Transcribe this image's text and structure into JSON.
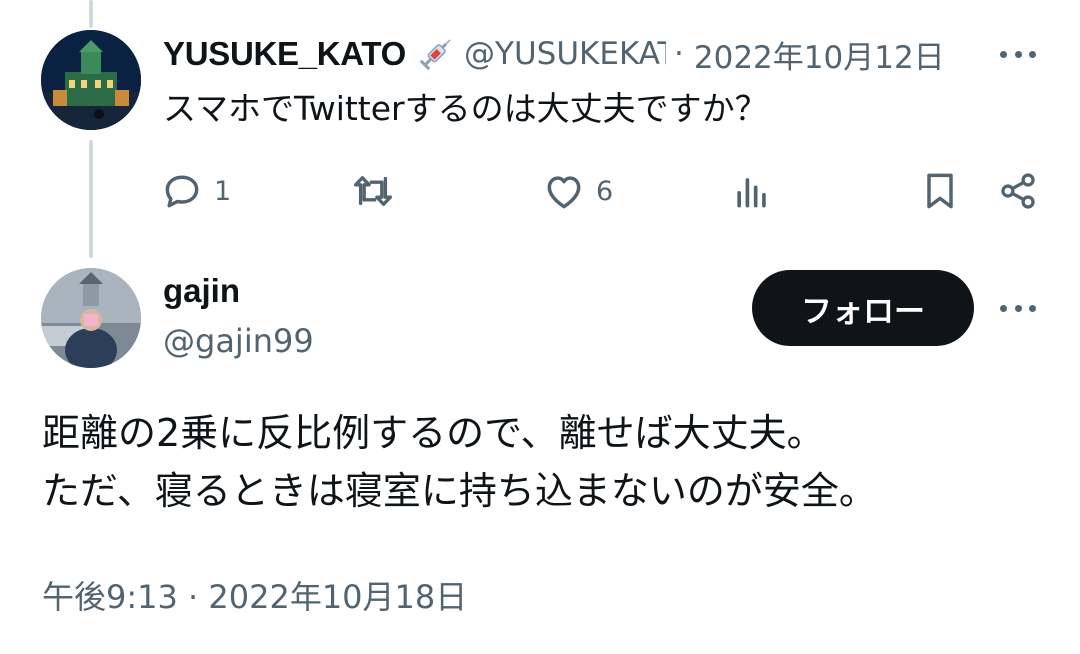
{
  "parent_tweet": {
    "display_name": "YUSUKE_KATO",
    "badge_icon": "syringe-emoji",
    "handle": "@YUSUKEKATO",
    "separator": "·",
    "date": "2022年10月12日",
    "text": "スマホでTwitterするのは大丈夫ですか？",
    "actions": {
      "reply_count": "1",
      "retweet_count": "",
      "like_count": "6"
    }
  },
  "reply_tweet": {
    "display_name": "gajin",
    "handle": "@gajin99",
    "follow_label": "フォロー",
    "body_lines": [
      "距離の2乗に反比例するので、離せば大丈夫。",
      "ただ、寝るときは寝室に持ち込まないのが安全。"
    ],
    "meta": "午後9:13 · 2022年10月18日"
  },
  "colors": {
    "text_primary": "#0f1419",
    "text_secondary": "#536471",
    "thread_line": "#cfd9de",
    "follow_button_bg": "#0f1419"
  }
}
